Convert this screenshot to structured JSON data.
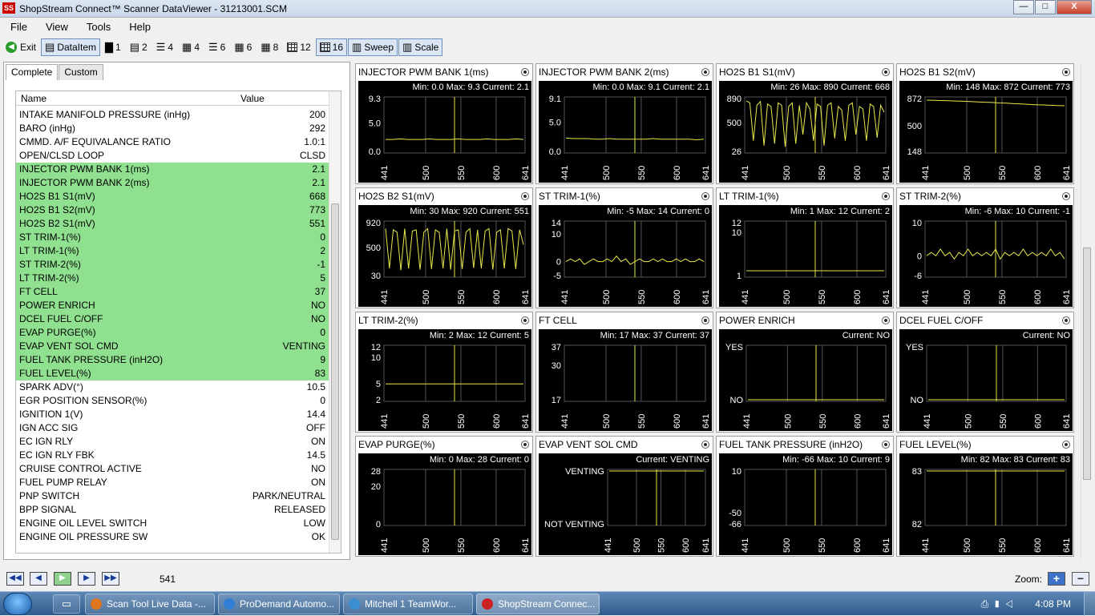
{
  "window": {
    "title": "ShopStream Connect™ Scanner DataViewer - 31213001.SCM",
    "logo": "SS",
    "minimize": "—",
    "maximize": "□",
    "close": "X"
  },
  "menu": [
    "File",
    "View",
    "Tools",
    "Help"
  ],
  "toolbar": {
    "exit": "Exit",
    "dataitem": "DataItem",
    "layouts": [
      "1",
      "2",
      "4",
      "4",
      "6",
      "6",
      "8",
      "12",
      "16"
    ],
    "sweep": "Sweep",
    "scale": "Scale"
  },
  "tabs": [
    "Complete",
    "Custom"
  ],
  "list": {
    "headers": {
      "name": "Name",
      "value": "Value"
    },
    "rows": [
      {
        "name": "INTAKE MANIFOLD PRESSURE (inHg)",
        "value": "200",
        "sel": false
      },
      {
        "name": "BARO (inHg)",
        "value": "292",
        "sel": false
      },
      {
        "name": "CMMD. A/F EQUIVALANCE RATIO",
        "value": "1.0:1",
        "sel": false
      },
      {
        "name": "OPEN/CLSD LOOP",
        "value": "CLSD",
        "sel": false
      },
      {
        "name": "INJECTOR PWM BANK 1(ms)",
        "value": "2.1",
        "sel": true
      },
      {
        "name": "INJECTOR PWM BANK 2(ms)",
        "value": "2.1",
        "sel": true
      },
      {
        "name": "HO2S B1 S1(mV)",
        "value": "668",
        "sel": true
      },
      {
        "name": "HO2S B1 S2(mV)",
        "value": "773",
        "sel": true
      },
      {
        "name": "HO2S B2 S1(mV)",
        "value": "551",
        "sel": true
      },
      {
        "name": "ST TRIM-1(%)",
        "value": "0",
        "sel": true
      },
      {
        "name": "LT TRIM-1(%)",
        "value": "2",
        "sel": true
      },
      {
        "name": "ST TRIM-2(%)",
        "value": "-1",
        "sel": true
      },
      {
        "name": "LT TRIM-2(%)",
        "value": "5",
        "sel": true
      },
      {
        "name": "FT CELL",
        "value": "37",
        "sel": true
      },
      {
        "name": "POWER ENRICH",
        "value": "NO",
        "sel": true
      },
      {
        "name": "DCEL FUEL C/OFF",
        "value": "NO",
        "sel": true
      },
      {
        "name": "EVAP PURGE(%)",
        "value": "0",
        "sel": true
      },
      {
        "name": "EVAP VENT SOL CMD",
        "value": "VENTING",
        "sel": true
      },
      {
        "name": "FUEL TANK PRESSURE  (inH2O)",
        "value": "9",
        "sel": true
      },
      {
        "name": "FUEL LEVEL(%)",
        "value": "83",
        "sel": true
      },
      {
        "name": "SPARK ADV(°)",
        "value": "10.5",
        "sel": false
      },
      {
        "name": "EGR POSITION SENSOR(%)",
        "value": "0",
        "sel": false
      },
      {
        "name": "IGNITION 1(V)",
        "value": "14.4",
        "sel": false
      },
      {
        "name": "IGN ACC SIG",
        "value": "OFF",
        "sel": false
      },
      {
        "name": "EC IGN RLY",
        "value": "ON",
        "sel": false
      },
      {
        "name": "EC IGN RLY FBK",
        "value": "14.5",
        "sel": false
      },
      {
        "name": "CRUISE CONTROL ACTIVE",
        "value": "NO",
        "sel": false
      },
      {
        "name": "FUEL PUMP RELAY",
        "value": "ON",
        "sel": false
      },
      {
        "name": "PNP SWITCH",
        "value": "PARK/NEUTRAL",
        "sel": false
      },
      {
        "name": "BPP SIGNAL",
        "value": "RELEASED",
        "sel": false
      },
      {
        "name": "ENGINE OIL LEVEL SWITCH",
        "value": "LOW",
        "sel": false
      },
      {
        "name": "ENGINE OIL PRESSURE SW",
        "value": "OK",
        "sel": false
      }
    ]
  },
  "chart_data": [
    {
      "type": "line",
      "title": "INJECTOR PWM BANK 1(ms)",
      "stats": "Min: 0.0    Max: 9.3    Current: 2.1",
      "yticks": [
        "9.3",
        "5.0",
        "0.0"
      ],
      "ylim": [
        0,
        9.3
      ],
      "xticks": [
        "441",
        "500",
        "550",
        "600",
        "641"
      ],
      "xlim": [
        441,
        641
      ],
      "cursor": 541,
      "values": [
        2.1,
        2.1,
        2.2,
        2.1,
        2.1,
        2.1,
        2.2,
        2.1,
        2.1,
        2.1,
        2.2,
        2.1,
        2.1,
        2.1,
        2.2,
        2.1,
        2.1,
        2.1,
        2.2,
        2.1
      ]
    },
    {
      "type": "line",
      "title": "INJECTOR PWM BANK 2(ms)",
      "stats": "Min: 0.0    Max: 9.1    Current: 2.1",
      "yticks": [
        "9.1",
        "5.0",
        "0.0"
      ],
      "ylim": [
        0,
        9.1
      ],
      "xticks": [
        "441",
        "500",
        "550",
        "600",
        "641"
      ],
      "xlim": [
        441,
        641
      ],
      "cursor": 541,
      "values": [
        2.3,
        2.2,
        2.2,
        2.2,
        2.1,
        2.1,
        2.2,
        2.1,
        2.1,
        2.1,
        2.1,
        2.1,
        2.2,
        2.1,
        2.1,
        2.1,
        2.1,
        2.1,
        2.0,
        2.1
      ]
    },
    {
      "type": "line",
      "title": "HO2S B1 S1(mV)",
      "stats": "Min: 26    Max: 890    Current: 668",
      "yticks": [
        "890",
        "500",
        "26"
      ],
      "ylim": [
        26,
        890
      ],
      "xticks": [
        "441",
        "500",
        "550",
        "600",
        "641"
      ],
      "xlim": [
        441,
        641
      ],
      "cursor": 541,
      "values": [
        850,
        820,
        200,
        780,
        840,
        120,
        800,
        760,
        150,
        820,
        780,
        100,
        760,
        820,
        150,
        780,
        300,
        820,
        720,
        200,
        800,
        760,
        120,
        780,
        820,
        240,
        760,
        700,
        200,
        780,
        820,
        300,
        760,
        720,
        200,
        800,
        760,
        250,
        780,
        668
      ]
    },
    {
      "type": "line",
      "title": "HO2S B1 S2(mV)",
      "stats": "Min: 148    Max: 872    Current: 773",
      "yticks": [
        "872",
        "500",
        "148"
      ],
      "ylim": [
        148,
        872
      ],
      "xticks": [
        "441",
        "500",
        "550",
        "600",
        "641"
      ],
      "xlim": [
        441,
        641
      ],
      "cursor": 541,
      "values": [
        850,
        848,
        845,
        842,
        838,
        835,
        830,
        826,
        822,
        818,
        812,
        808,
        802,
        798,
        792,
        788,
        784,
        780,
        776,
        773
      ]
    },
    {
      "type": "line",
      "title": "HO2S B2 S1(mV)",
      "stats": "Min: 30    Max: 920    Current: 551",
      "yticks": [
        "920",
        "500",
        "30"
      ],
      "ylim": [
        30,
        920
      ],
      "xticks": [
        "441",
        "500",
        "550",
        "600",
        "641"
      ],
      "xlim": [
        441,
        641
      ],
      "cursor": 541,
      "values": [
        820,
        150,
        800,
        760,
        120,
        820,
        150,
        780,
        800,
        130,
        760,
        820,
        140,
        800,
        760,
        150,
        820,
        130,
        780,
        800,
        140,
        760,
        820,
        160,
        800,
        150,
        780,
        820,
        130,
        760,
        800,
        150,
        820,
        780,
        140,
        800,
        551
      ]
    },
    {
      "type": "line",
      "title": "ST TRIM-1(%)",
      "stats": "Min: -5    Max: 14    Current: 0",
      "yticks": [
        "14",
        "10",
        "0",
        "-5"
      ],
      "ylim": [
        -5,
        14
      ],
      "xticks": [
        "441",
        "500",
        "550",
        "600",
        "641"
      ],
      "xlim": [
        441,
        641
      ],
      "cursor": 541,
      "values": [
        0,
        1,
        0,
        1,
        -1,
        0,
        1,
        0,
        0,
        1,
        0,
        2,
        0,
        1,
        -1,
        0,
        1,
        0,
        0,
        1,
        0,
        1,
        0,
        0,
        1,
        0,
        1,
        0,
        0,
        1,
        0
      ]
    },
    {
      "type": "line",
      "title": "LT TRIM-1(%)",
      "stats": "Min: 1    Max: 12    Current: 2",
      "yticks": [
        "12",
        "10",
        "1"
      ],
      "ylim": [
        1,
        12
      ],
      "xticks": [
        "441",
        "500",
        "550",
        "600",
        "641"
      ],
      "xlim": [
        441,
        641
      ],
      "cursor": 541,
      "values": [
        2,
        2,
        2,
        2,
        2,
        2,
        2,
        2,
        2,
        2,
        2,
        2
      ]
    },
    {
      "type": "line",
      "title": "ST TRIM-2(%)",
      "stats": "Min: -6    Max: 10    Current: -1",
      "yticks": [
        "10",
        "0",
        "-6"
      ],
      "ylim": [
        -6,
        10
      ],
      "xticks": [
        "441",
        "500",
        "550",
        "600",
        "641"
      ],
      "xlim": [
        441,
        641
      ],
      "cursor": 541,
      "values": [
        0,
        1,
        0,
        2,
        0,
        1,
        -1,
        1,
        0,
        2,
        0,
        1,
        0,
        1,
        0,
        2,
        -1,
        1,
        0,
        1,
        0,
        2,
        0,
        1,
        0,
        1,
        0,
        2,
        0,
        1,
        -1
      ]
    },
    {
      "type": "line",
      "title": "LT TRIM-2(%)",
      "stats": "Min: 2    Max: 12    Current: 5",
      "yticks": [
        "12",
        "10",
        "5",
        "2"
      ],
      "ylim": [
        2,
        12
      ],
      "xticks": [
        "441",
        "500",
        "550",
        "600",
        "641"
      ],
      "xlim": [
        441,
        641
      ],
      "cursor": 541,
      "values": [
        5,
        5,
        5,
        5,
        5,
        5,
        5,
        5,
        5,
        5
      ]
    },
    {
      "type": "line",
      "title": "FT CELL",
      "stats": "Min: 17    Max: 37    Current: 37",
      "yticks": [
        "37",
        "30",
        "17"
      ],
      "ylim": [
        17,
        37
      ],
      "xticks": [
        "441",
        "500",
        "550",
        "600",
        "641"
      ],
      "xlim": [
        441,
        641
      ],
      "cursor": 541,
      "values": []
    },
    {
      "type": "line",
      "title": "POWER ENRICH",
      "stats": "Current: NO",
      "yticks": [
        "YES",
        "NO"
      ],
      "ylim": [
        0,
        1
      ],
      "xticks": [
        "441",
        "500",
        "550",
        "600",
        "641"
      ],
      "xlim": [
        441,
        641
      ],
      "cursor": 541,
      "values": [
        0,
        0,
        0,
        0,
        0,
        0,
        0,
        0
      ]
    },
    {
      "type": "line",
      "title": "DCEL FUEL C/OFF",
      "stats": "Current: NO",
      "yticks": [
        "YES",
        "NO"
      ],
      "ylim": [
        0,
        1
      ],
      "xticks": [
        "441",
        "500",
        "550",
        "600",
        "641"
      ],
      "xlim": [
        441,
        641
      ],
      "cursor": 541,
      "values": [
        0,
        0,
        0,
        0,
        0,
        0,
        0,
        0
      ]
    },
    {
      "type": "line",
      "title": "EVAP PURGE(%)",
      "stats": "Min: 0    Max: 28    Current: 0",
      "yticks": [
        "28",
        "20",
        "0"
      ],
      "ylim": [
        0,
        28
      ],
      "xticks": [
        "441",
        "500",
        "550",
        "600",
        "641"
      ],
      "xlim": [
        441,
        641
      ],
      "cursor": 541,
      "values": []
    },
    {
      "type": "line",
      "title": "EVAP VENT SOL CMD",
      "stats": "Current: VENTING",
      "yticks": [
        "VENTING",
        "NOT VENTING"
      ],
      "ylim": [
        0,
        1
      ],
      "xticks": [
        "441",
        "500",
        "550",
        "600",
        "641"
      ],
      "xlim": [
        441,
        641
      ],
      "cursor": 541,
      "values": [
        1,
        1,
        1,
        1,
        1,
        1,
        1,
        1
      ]
    },
    {
      "type": "line",
      "title": "FUEL TANK PRESSURE  (inH2O)",
      "stats": "Min: -66    Max: 10    Current: 9",
      "yticks": [
        "10",
        "-50",
        "-66"
      ],
      "ylim": [
        -66,
        10
      ],
      "xticks": [
        "441",
        "500",
        "550",
        "600",
        "641"
      ],
      "xlim": [
        441,
        641
      ],
      "cursor": 541,
      "values": []
    },
    {
      "type": "line",
      "title": "FUEL LEVEL(%)",
      "stats": "Min: 82    Max: 83    Current: 83",
      "yticks": [
        "83",
        "82"
      ],
      "ylim": [
        82,
        83
      ],
      "xticks": [
        "441",
        "500",
        "550",
        "600",
        "641"
      ],
      "xlim": [
        441,
        641
      ],
      "cursor": 541,
      "values": [
        83,
        83,
        83,
        83,
        83,
        83,
        83,
        83
      ]
    }
  ],
  "bottom": {
    "frame": "541",
    "zoom_label": "Zoom:",
    "zoom_in": "+",
    "zoom_out": "−"
  },
  "taskbar": {
    "tasks": [
      {
        "label": "Scan Tool Live Data -...",
        "color": "#e0761c"
      },
      {
        "label": "ProDemand Automo...",
        "color": "#2f7fd6"
      },
      {
        "label": "Mitchell 1 TeamWor...",
        "color": "#3a8fd0"
      },
      {
        "label": "ShopStream Connec...",
        "color": "#cc2222"
      }
    ],
    "clock": "4:08 PM",
    "tray_icons": "⎙▮◁"
  },
  "colors": {
    "trace": "#e8e84a",
    "cursor": "#e8e84a",
    "grid": "#555555",
    "selected_row": "#8fe08f"
  }
}
